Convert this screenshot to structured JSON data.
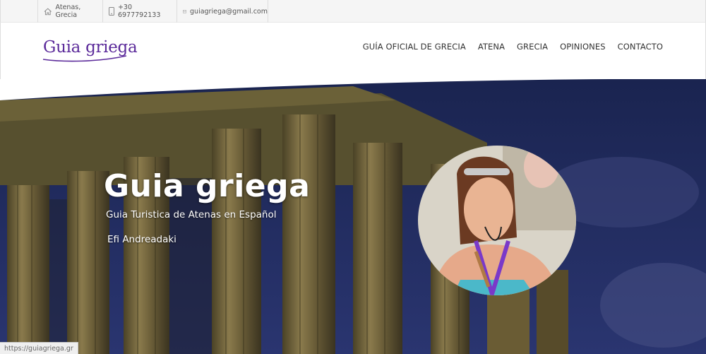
{
  "topbar": {
    "location": "Atenas, Grecia",
    "phone": "+30 6977792133",
    "email": "guiagriega@gmail.com"
  },
  "header": {
    "logo": "Guia griega",
    "nav": [
      "GUÍA OFICIAL DE GRECIA",
      "ATENA",
      "GRECIA",
      "OPINIONES",
      "CONTACTO"
    ]
  },
  "hero": {
    "title": "Guia griega",
    "subtitle": "Guia Turistica de Atenas en Español",
    "name": "Efi Andreadaki"
  },
  "statusbar": {
    "url": "https://guiagriega.gr"
  },
  "colors": {
    "brand": "#5b2a9a",
    "sky": "#223066"
  },
  "icons": [
    "home-icon",
    "phone-icon",
    "mail-icon"
  ]
}
